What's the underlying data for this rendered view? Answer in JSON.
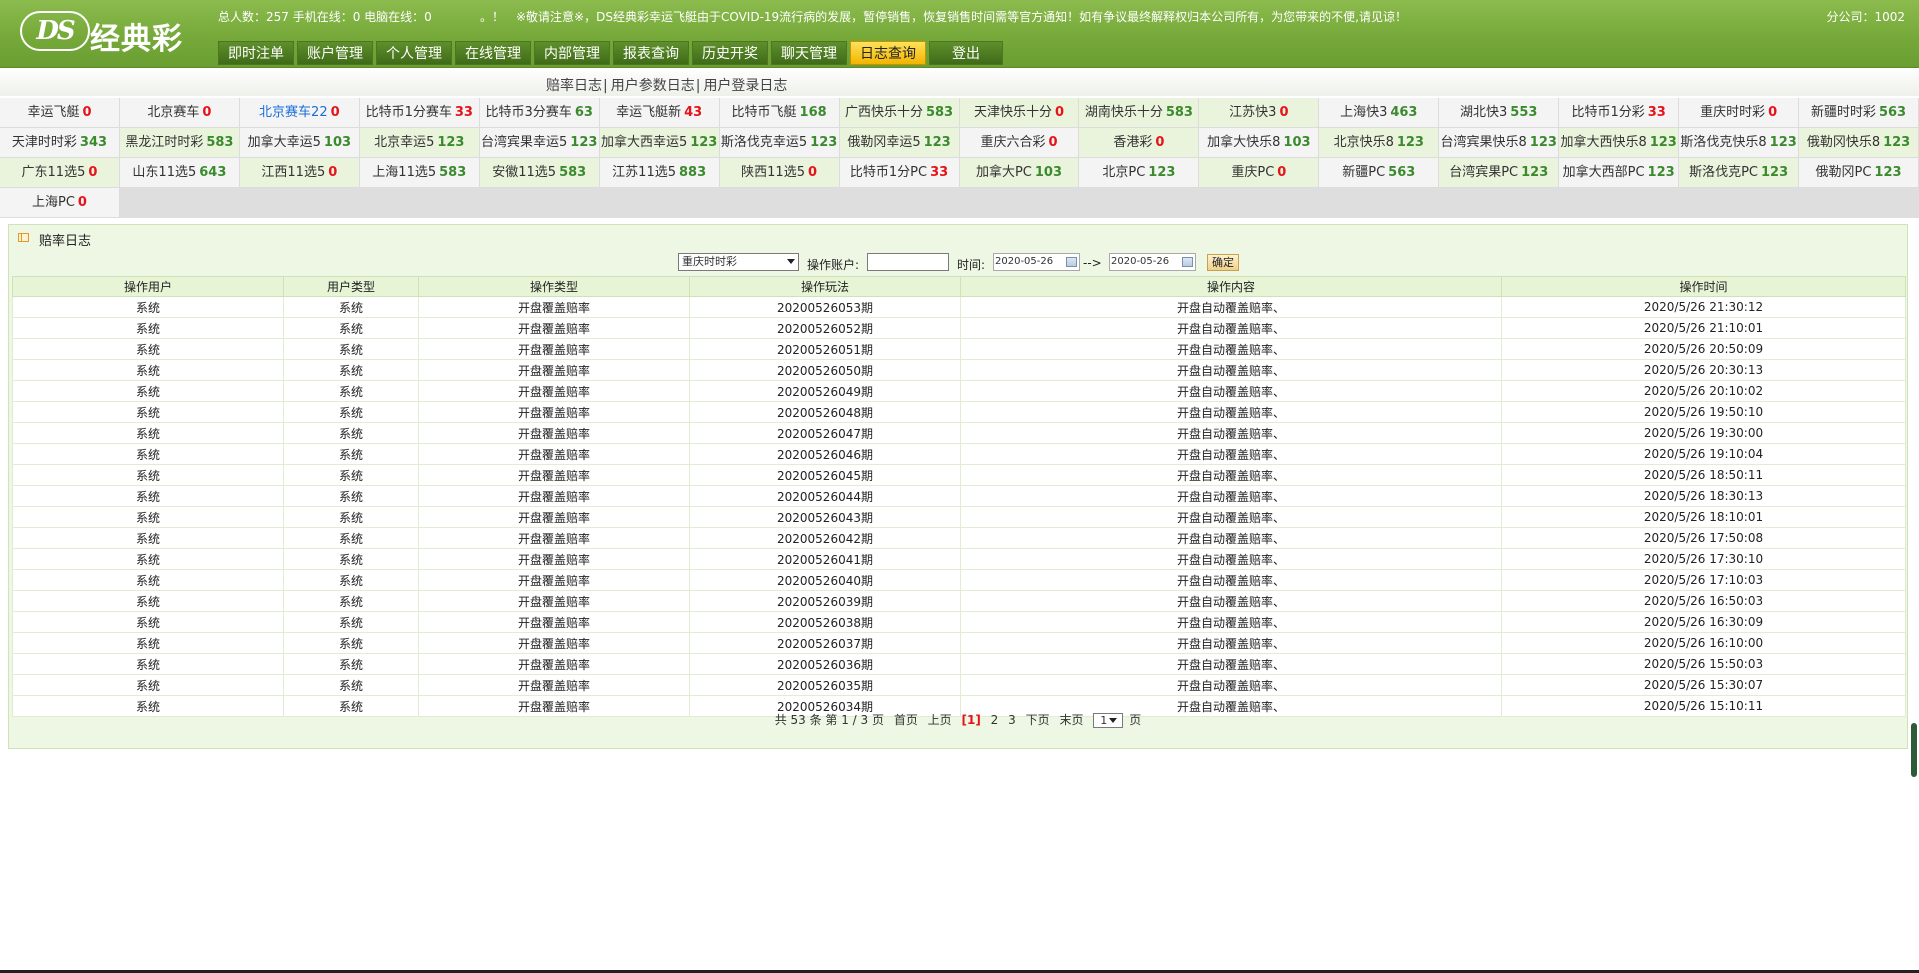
{
  "header": {
    "logo_ds": "DS",
    "logo_text": "经典彩",
    "stats": "总人数：257 手机在线：0 电脑在线：0",
    "notice": "。！　※敬请注意※，DS经典彩幸运飞艇由于COVID-19流行病的发展，暂停销售，恢复销售时间需等官方通知！如有争议最终解释权归本公司所有，为您带来的不便,请见谅！",
    "company": "分公司：1002"
  },
  "nav": [
    {
      "label": "即时注单",
      "active": false
    },
    {
      "label": "账户管理",
      "active": false
    },
    {
      "label": "个人管理",
      "active": false
    },
    {
      "label": "在线管理",
      "active": false
    },
    {
      "label": "内部管理",
      "active": false
    },
    {
      "label": "报表查询",
      "active": false
    },
    {
      "label": "历史开奖",
      "active": false
    },
    {
      "label": "聊天管理",
      "active": false
    },
    {
      "label": "日志查询",
      "active": true
    },
    {
      "label": "登出",
      "active": false
    }
  ],
  "submenu": [
    {
      "label": "赔率日志"
    },
    {
      "label": "用户参数日志"
    },
    {
      "label": "用户登录日志"
    }
  ],
  "games": [
    {
      "name": "幸运飞艇",
      "count": "0",
      "selected": false
    },
    {
      "name": "北京赛车",
      "count": "0",
      "selected": false
    },
    {
      "name": "北京赛车22",
      "count": "0",
      "selected": true
    },
    {
      "name": "比特币1分赛车",
      "count": "33",
      "selected": false
    },
    {
      "name": "比特币3分赛车",
      "count": "63",
      "selected": false
    },
    {
      "name": "幸运飞艇新",
      "count": "43",
      "selected": false
    },
    {
      "name": "比特币飞艇",
      "count": "168",
      "selected": false
    },
    {
      "name": "广西快乐十分",
      "count": "583",
      "selected": false
    },
    {
      "name": "天津快乐十分",
      "count": "0",
      "selected": false
    },
    {
      "name": "湖南快乐十分",
      "count": "583",
      "selected": false
    },
    {
      "name": "江苏快3",
      "count": "0",
      "selected": false
    },
    {
      "name": "上海快3",
      "count": "463",
      "selected": false
    },
    {
      "name": "湖北快3",
      "count": "553",
      "selected": false
    },
    {
      "name": "比特币1分彩",
      "count": "33",
      "selected": false
    },
    {
      "name": "重庆时时彩",
      "count": "0",
      "selected": false
    },
    {
      "name": "新疆时时彩",
      "count": "563",
      "selected": false
    },
    {
      "name": "天津时时彩",
      "count": "343",
      "selected": false
    },
    {
      "name": "黑龙江时时彩",
      "count": "583",
      "selected": false
    },
    {
      "name": "加拿大幸运5",
      "count": "103",
      "selected": false
    },
    {
      "name": "北京幸运5",
      "count": "123",
      "selected": false
    },
    {
      "name": "台湾宾果幸运5",
      "count": "123",
      "selected": false
    },
    {
      "name": "加拿大西幸运5",
      "count": "123",
      "selected": false
    },
    {
      "name": "斯洛伐克幸运5",
      "count": "123",
      "selected": false
    },
    {
      "name": "俄勒冈幸运5",
      "count": "123",
      "selected": false
    },
    {
      "name": "重庆六合彩",
      "count": "0",
      "selected": false
    },
    {
      "name": "香港彩",
      "count": "0",
      "selected": false
    },
    {
      "name": "加拿大快乐8",
      "count": "103",
      "selected": false
    },
    {
      "name": "北京快乐8",
      "count": "123",
      "selected": false
    },
    {
      "name": "台湾宾果快乐8",
      "count": "123",
      "selected": false
    },
    {
      "name": "加拿大西快乐8",
      "count": "123",
      "selected": false
    },
    {
      "name": "斯洛伐克快乐8",
      "count": "123",
      "selected": false
    },
    {
      "name": "俄勒冈快乐8",
      "count": "123",
      "selected": false
    },
    {
      "name": "广东11选5",
      "count": "0",
      "selected": false
    },
    {
      "name": "山东11选5",
      "count": "643",
      "selected": false
    },
    {
      "name": "江西11选5",
      "count": "0",
      "selected": false
    },
    {
      "name": "上海11选5",
      "count": "583",
      "selected": false
    },
    {
      "name": "安徽11选5",
      "count": "583",
      "selected": false
    },
    {
      "name": "江苏11选5",
      "count": "883",
      "selected": false
    },
    {
      "name": "陕西11选5",
      "count": "0",
      "selected": false
    },
    {
      "name": "比特币1分PC",
      "count": "33",
      "selected": false
    },
    {
      "name": "加拿大PC",
      "count": "103",
      "selected": false
    },
    {
      "name": "北京PC",
      "count": "123",
      "selected": false
    },
    {
      "name": "重庆PC",
      "count": "0",
      "selected": false
    },
    {
      "name": "新疆PC",
      "count": "563",
      "selected": false
    },
    {
      "name": "台湾宾果PC",
      "count": "123",
      "selected": false
    },
    {
      "name": "加拿大西部PC",
      "count": "123",
      "selected": false
    },
    {
      "name": "斯洛伐克PC",
      "count": "123",
      "selected": false
    },
    {
      "name": "俄勒冈PC",
      "count": "123",
      "selected": false
    },
    {
      "name": "上海PC",
      "count": "0",
      "selected": false
    }
  ],
  "panel": {
    "title": "赔率日志",
    "filter": {
      "lottery": "重庆时时彩",
      "account_label": "操作账户:",
      "account_value": "",
      "time_label": "时间:",
      "date_from": "2020-05-26",
      "date_sep": "-->",
      "date_to": "2020-05-26",
      "confirm": "确定"
    },
    "columns": [
      "操作用户",
      "用户类型",
      "操作类型",
      "操作玩法",
      "操作内容",
      "操作时间"
    ],
    "rows": [
      [
        "系统",
        "系统",
        "开盘覆盖赔率",
        "20200526053期",
        "开盘自动覆盖赔率、",
        "2020/5/26 21:30:12"
      ],
      [
        "系统",
        "系统",
        "开盘覆盖赔率",
        "20200526052期",
        "开盘自动覆盖赔率、",
        "2020/5/26 21:10:01"
      ],
      [
        "系统",
        "系统",
        "开盘覆盖赔率",
        "20200526051期",
        "开盘自动覆盖赔率、",
        "2020/5/26 20:50:09"
      ],
      [
        "系统",
        "系统",
        "开盘覆盖赔率",
        "20200526050期",
        "开盘自动覆盖赔率、",
        "2020/5/26 20:30:13"
      ],
      [
        "系统",
        "系统",
        "开盘覆盖赔率",
        "20200526049期",
        "开盘自动覆盖赔率、",
        "2020/5/26 20:10:02"
      ],
      [
        "系统",
        "系统",
        "开盘覆盖赔率",
        "20200526048期",
        "开盘自动覆盖赔率、",
        "2020/5/26 19:50:10"
      ],
      [
        "系统",
        "系统",
        "开盘覆盖赔率",
        "20200526047期",
        "开盘自动覆盖赔率、",
        "2020/5/26 19:30:00"
      ],
      [
        "系统",
        "系统",
        "开盘覆盖赔率",
        "20200526046期",
        "开盘自动覆盖赔率、",
        "2020/5/26 19:10:04"
      ],
      [
        "系统",
        "系统",
        "开盘覆盖赔率",
        "20200526045期",
        "开盘自动覆盖赔率、",
        "2020/5/26 18:50:11"
      ],
      [
        "系统",
        "系统",
        "开盘覆盖赔率",
        "20200526044期",
        "开盘自动覆盖赔率、",
        "2020/5/26 18:30:13"
      ],
      [
        "系统",
        "系统",
        "开盘覆盖赔率",
        "20200526043期",
        "开盘自动覆盖赔率、",
        "2020/5/26 18:10:01"
      ],
      [
        "系统",
        "系统",
        "开盘覆盖赔率",
        "20200526042期",
        "开盘自动覆盖赔率、",
        "2020/5/26 17:50:08"
      ],
      [
        "系统",
        "系统",
        "开盘覆盖赔率",
        "20200526041期",
        "开盘自动覆盖赔率、",
        "2020/5/26 17:30:10"
      ],
      [
        "系统",
        "系统",
        "开盘覆盖赔率",
        "20200526040期",
        "开盘自动覆盖赔率、",
        "2020/5/26 17:10:03"
      ],
      [
        "系统",
        "系统",
        "开盘覆盖赔率",
        "20200526039期",
        "开盘自动覆盖赔率、",
        "2020/5/26 16:50:03"
      ],
      [
        "系统",
        "系统",
        "开盘覆盖赔率",
        "20200526038期",
        "开盘自动覆盖赔率、",
        "2020/5/26 16:30:09"
      ],
      [
        "系统",
        "系统",
        "开盘覆盖赔率",
        "20200526037期",
        "开盘自动覆盖赔率、",
        "2020/5/26 16:10:00"
      ],
      [
        "系统",
        "系统",
        "开盘覆盖赔率",
        "20200526036期",
        "开盘自动覆盖赔率、",
        "2020/5/26 15:50:03"
      ],
      [
        "系统",
        "系统",
        "开盘覆盖赔率",
        "20200526035期",
        "开盘自动覆盖赔率、",
        "2020/5/26 15:30:07"
      ],
      [
        "系统",
        "系统",
        "开盘覆盖赔率",
        "20200526034期",
        "开盘自动覆盖赔率、",
        "2020/5/26 15:10:11"
      ]
    ],
    "pager": {
      "summary": "共 53 条 第 1 / 3 页",
      "first": "首页",
      "prev": "上页",
      "current": "[1]",
      "pages": [
        "2",
        "3"
      ],
      "next": "下页",
      "last": "末页",
      "select_value": "1",
      "suffix": "页"
    }
  },
  "colors": {
    "header_green": "#76a93a",
    "nav_active": "#f2b400",
    "count_red": "#e5141a",
    "count_green": "#3b8a2e",
    "selected_blue": "#1a6fd6"
  }
}
